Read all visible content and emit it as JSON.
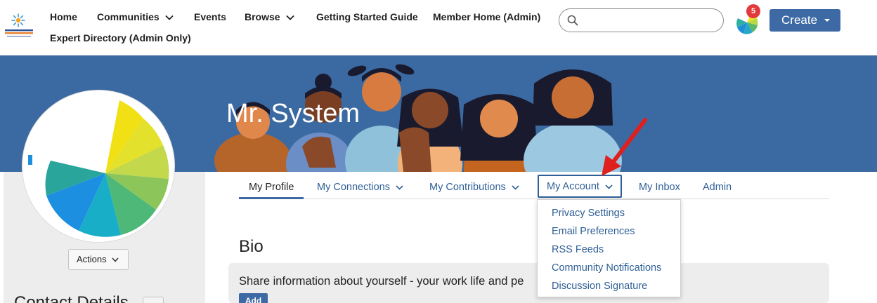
{
  "nav": {
    "home": "Home",
    "communities": "Communities",
    "events": "Events",
    "browse": "Browse",
    "getting_started": "Getting Started Guide",
    "member_home": "Member Home (Admin)",
    "expert_directory": "Expert Directory (Admin Only)"
  },
  "search": {
    "placeholder": ""
  },
  "notifications": {
    "count": "5"
  },
  "create": {
    "label": "Create"
  },
  "profile": {
    "name": "Mr. System",
    "actions_label": "Actions"
  },
  "tabs": [
    {
      "label": "My Profile"
    },
    {
      "label": "My Connections"
    },
    {
      "label": "My Contributions"
    },
    {
      "label": "My Account"
    },
    {
      "label": "My Inbox"
    },
    {
      "label": "Admin"
    }
  ],
  "account_menu": [
    {
      "label": "Privacy Settings"
    },
    {
      "label": "Email Preferences"
    },
    {
      "label": "RSS Feeds"
    },
    {
      "label": "Community Notifications"
    },
    {
      "label": "Discussion Signature"
    }
  ],
  "bio": {
    "title": "Bio",
    "prompt": "Share information about yourself - your work life and pe",
    "add_label": "Add"
  },
  "contact": {
    "title": "Contact Details"
  },
  "colors": {
    "accent": "#3d6aa5",
    "banner": "#3b6aa2",
    "link": "#2e5f96",
    "badge": "#e23a3a",
    "arrow": "#e01f1f"
  }
}
